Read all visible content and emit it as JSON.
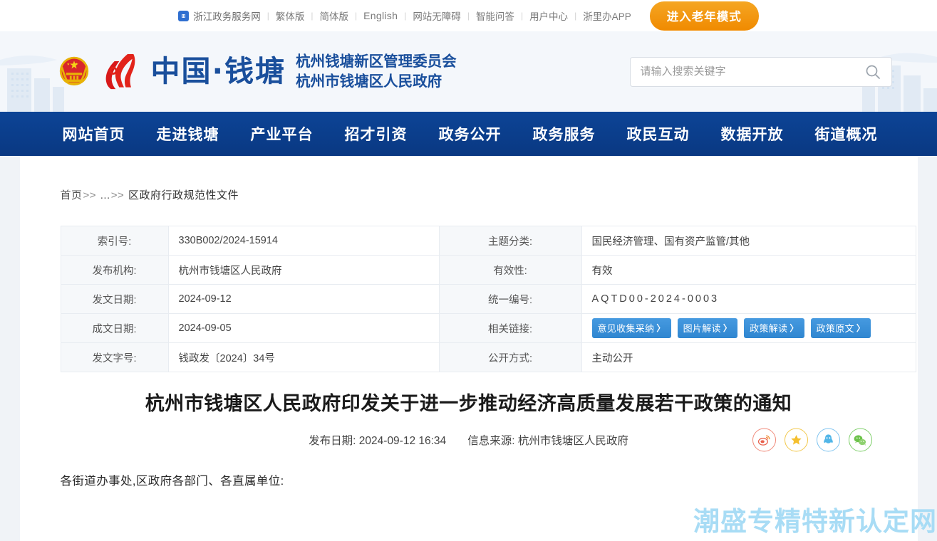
{
  "topbar": {
    "portal_link": "浙江政务服务网",
    "portal_icon": "zhejiang-gov-icon",
    "links": [
      "繁体版",
      "简体版",
      "English",
      "网站无障碍",
      "智能问答",
      "用户中心",
      "浙里办APP"
    ],
    "elder_mode_button": "进入老年模式"
  },
  "header": {
    "emblem_icon": "national-emblem-icon",
    "flame_icon": "qiantang-flame-logo-icon",
    "site_title": "中国·钱塘",
    "subtitle_line1": "杭州钱塘新区管理委员会",
    "subtitle_line2": "杭州市钱塘区人民政府",
    "search": {
      "placeholder": "请输入搜索关键字",
      "value": "",
      "icon": "search-icon"
    }
  },
  "nav": {
    "items": [
      "网站首页",
      "走进钱塘",
      "产业平台",
      "招才引资",
      "政务公开",
      "政务服务",
      "政民互动",
      "数据开放",
      "街道概况"
    ]
  },
  "breadcrumb": {
    "home": "首页",
    "sep1": ">>",
    "ellipsis": "...",
    "sep2": ">>",
    "current": "区政府行政规范性文件"
  },
  "info_table": {
    "rows": [
      {
        "left_key": "索引号:",
        "left_value": "330B002/2024-15914",
        "right_key": "主题分类:",
        "right_value": "国民经济管理、国有资产监管/其他"
      },
      {
        "left_key": "发布机构:",
        "left_value": "杭州市钱塘区人民政府",
        "right_key": "有效性:",
        "right_value": "有效"
      },
      {
        "left_key": "发文日期:",
        "left_value": "2024-09-12",
        "right_key": "统一编号:",
        "right_value": "AQTD00-2024-0003"
      },
      {
        "left_key": "成文日期:",
        "left_value": "2024-09-05",
        "right_key": "相关链接:",
        "right_value": ""
      },
      {
        "left_key": "发文字号:",
        "left_value": "钱政发〔2024〕34号",
        "right_key": "公开方式:",
        "right_value": "主动公开"
      }
    ],
    "related_links": [
      {
        "label": "意见收集采纳",
        "chevron": "〉"
      },
      {
        "label": "图片解读",
        "chevron": "〉"
      },
      {
        "label": "政策解读",
        "chevron": "〉"
      },
      {
        "label": "政策原文",
        "chevron": "〉"
      }
    ]
  },
  "article": {
    "title": "杭州市钱塘区人民政府印发关于进一步推动经济高质量发展若干政策的通知",
    "publish_label": "发布日期:",
    "publish_date": "2024-09-12 16:34",
    "source_label": "信息来源:",
    "source": "杭州市钱塘区人民政府",
    "body_paragraph_1": "各街道办事处,区政府各部门、各直属单位:",
    "share": [
      {
        "name": "weibo-share-icon",
        "title": "微博"
      },
      {
        "name": "favorite-star-icon",
        "title": "收藏"
      },
      {
        "name": "qq-share-icon",
        "title": "QQ"
      },
      {
        "name": "wechat-share-icon",
        "title": "微信"
      }
    ]
  },
  "watermark": "潮盛专精特新认定网",
  "colors": {
    "nav_blue": "#0b3c8c",
    "title_blue": "#1a4f9c",
    "accent_orange": "#f08a00",
    "badge_blue": "#3d8fd6",
    "watermark_blue": "#a8dcf5"
  }
}
